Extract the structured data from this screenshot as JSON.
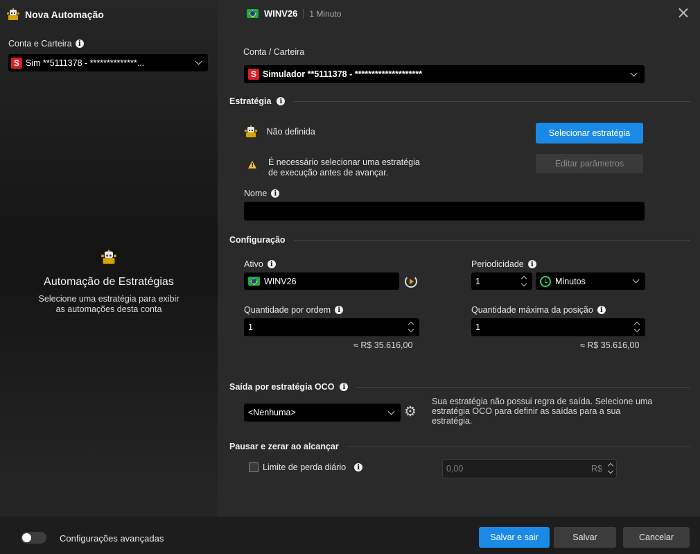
{
  "left": {
    "title": "Nova Automação",
    "account_label": "Conta e Carteira",
    "account_badge": "S",
    "account_value": "Sim **5111378 - **************...",
    "empty_title": "Automação de Estratégias",
    "empty_desc_line1": "Selecione uma estratégia para exibir",
    "empty_desc_line2": "as automações desta conta"
  },
  "header": {
    "symbol": "WINV26",
    "timeframe": "1 Minuto"
  },
  "account": {
    "label": "Conta / Carteira",
    "badge": "S",
    "value": "Simulador **5111378 - ********************"
  },
  "strategy": {
    "section": "Estratégia",
    "status": "Não definida",
    "select_button": "Selecionar estratégia",
    "edit_button": "Editar parâmetros",
    "warning_line1": "É necessário selecionar uma estratégia",
    "warning_line2": "de execução antes de avançar.",
    "name_label": "Nome",
    "name_value": ""
  },
  "config": {
    "section": "Configuração",
    "asset_label": "Ativo",
    "asset_value": "WINV26",
    "period_label": "Periodicidade",
    "period_value": "1",
    "period_unit": "Minutos",
    "qty_label": "Quantidade por ordem",
    "qty_value": "1",
    "qty_approx": "≈ R$ 35.616,00",
    "maxqty_label": "Quantidade máxima da posição",
    "maxqty_value": "1",
    "maxqty_approx": "≈ R$ 35.616,00"
  },
  "oco": {
    "section": "Saída por estratégia OCO",
    "select_value": "<Nenhuma>",
    "desc": "Sua estratégia não possui regra de saída. Selecione uma estratégia OCO para definir as saídas para a sua estratégia."
  },
  "pause": {
    "section": "Pausar e zerar ao alcançar",
    "daily_loss_label": "Limite de perda diário",
    "daily_loss_value": "0,00",
    "currency": "R$"
  },
  "footer": {
    "advanced_label": "Configurações avançadas",
    "save_exit": "Salvar e sair",
    "save": "Salvar",
    "cancel": "Cancelar"
  },
  "colors": {
    "primary": "#1a8ae6",
    "badge_red": "#d81f26",
    "warning": "#f2c12e",
    "clock_green": "#2dd36f"
  }
}
